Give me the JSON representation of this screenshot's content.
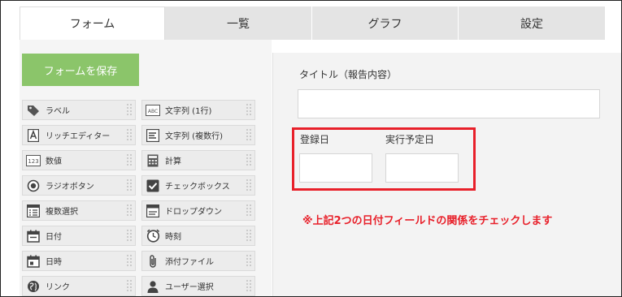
{
  "tabs": [
    {
      "label": "フォーム",
      "active": true
    },
    {
      "label": "一覧"
    },
    {
      "label": "グラフ"
    },
    {
      "label": "設定"
    }
  ],
  "palette": {
    "save_button": "フォームを保存",
    "items": [
      {
        "label": "ラベル",
        "icon": "tag-icon"
      },
      {
        "label": "文字列 (1行)",
        "icon": "abc-text-icon"
      },
      {
        "label": "リッチエディター",
        "icon": "rich-editor-icon"
      },
      {
        "label": "文字列 (複数行)",
        "icon": "multiline-text-icon"
      },
      {
        "label": "数値",
        "icon": "number-icon"
      },
      {
        "label": "計算",
        "icon": "calculator-icon"
      },
      {
        "label": "ラジオボタン",
        "icon": "radio-icon"
      },
      {
        "label": "チェックボックス",
        "icon": "checkbox-icon"
      },
      {
        "label": "複数選択",
        "icon": "multi-select-icon"
      },
      {
        "label": "ドロップダウン",
        "icon": "dropdown-icon"
      },
      {
        "label": "日付",
        "icon": "calendar-icon"
      },
      {
        "label": "時刻",
        "icon": "clock-icon"
      },
      {
        "label": "日時",
        "icon": "datetime-icon"
      },
      {
        "label": "添付ファイル",
        "icon": "paperclip-icon"
      },
      {
        "label": "リンク",
        "icon": "globe-icon"
      },
      {
        "label": "ユーザー選択",
        "icon": "user-icon"
      }
    ],
    "abc_badge": "ABC",
    "num_badge": "123"
  },
  "form": {
    "title_label": "タイトル（報告内容）",
    "date1_label": "登録日",
    "date2_label": "実行予定日",
    "note": "※上記2つの日付フィールドの関係をチェックします"
  },
  "colors": {
    "save_button": "#8bc56a",
    "highlight": "#e8202a"
  }
}
